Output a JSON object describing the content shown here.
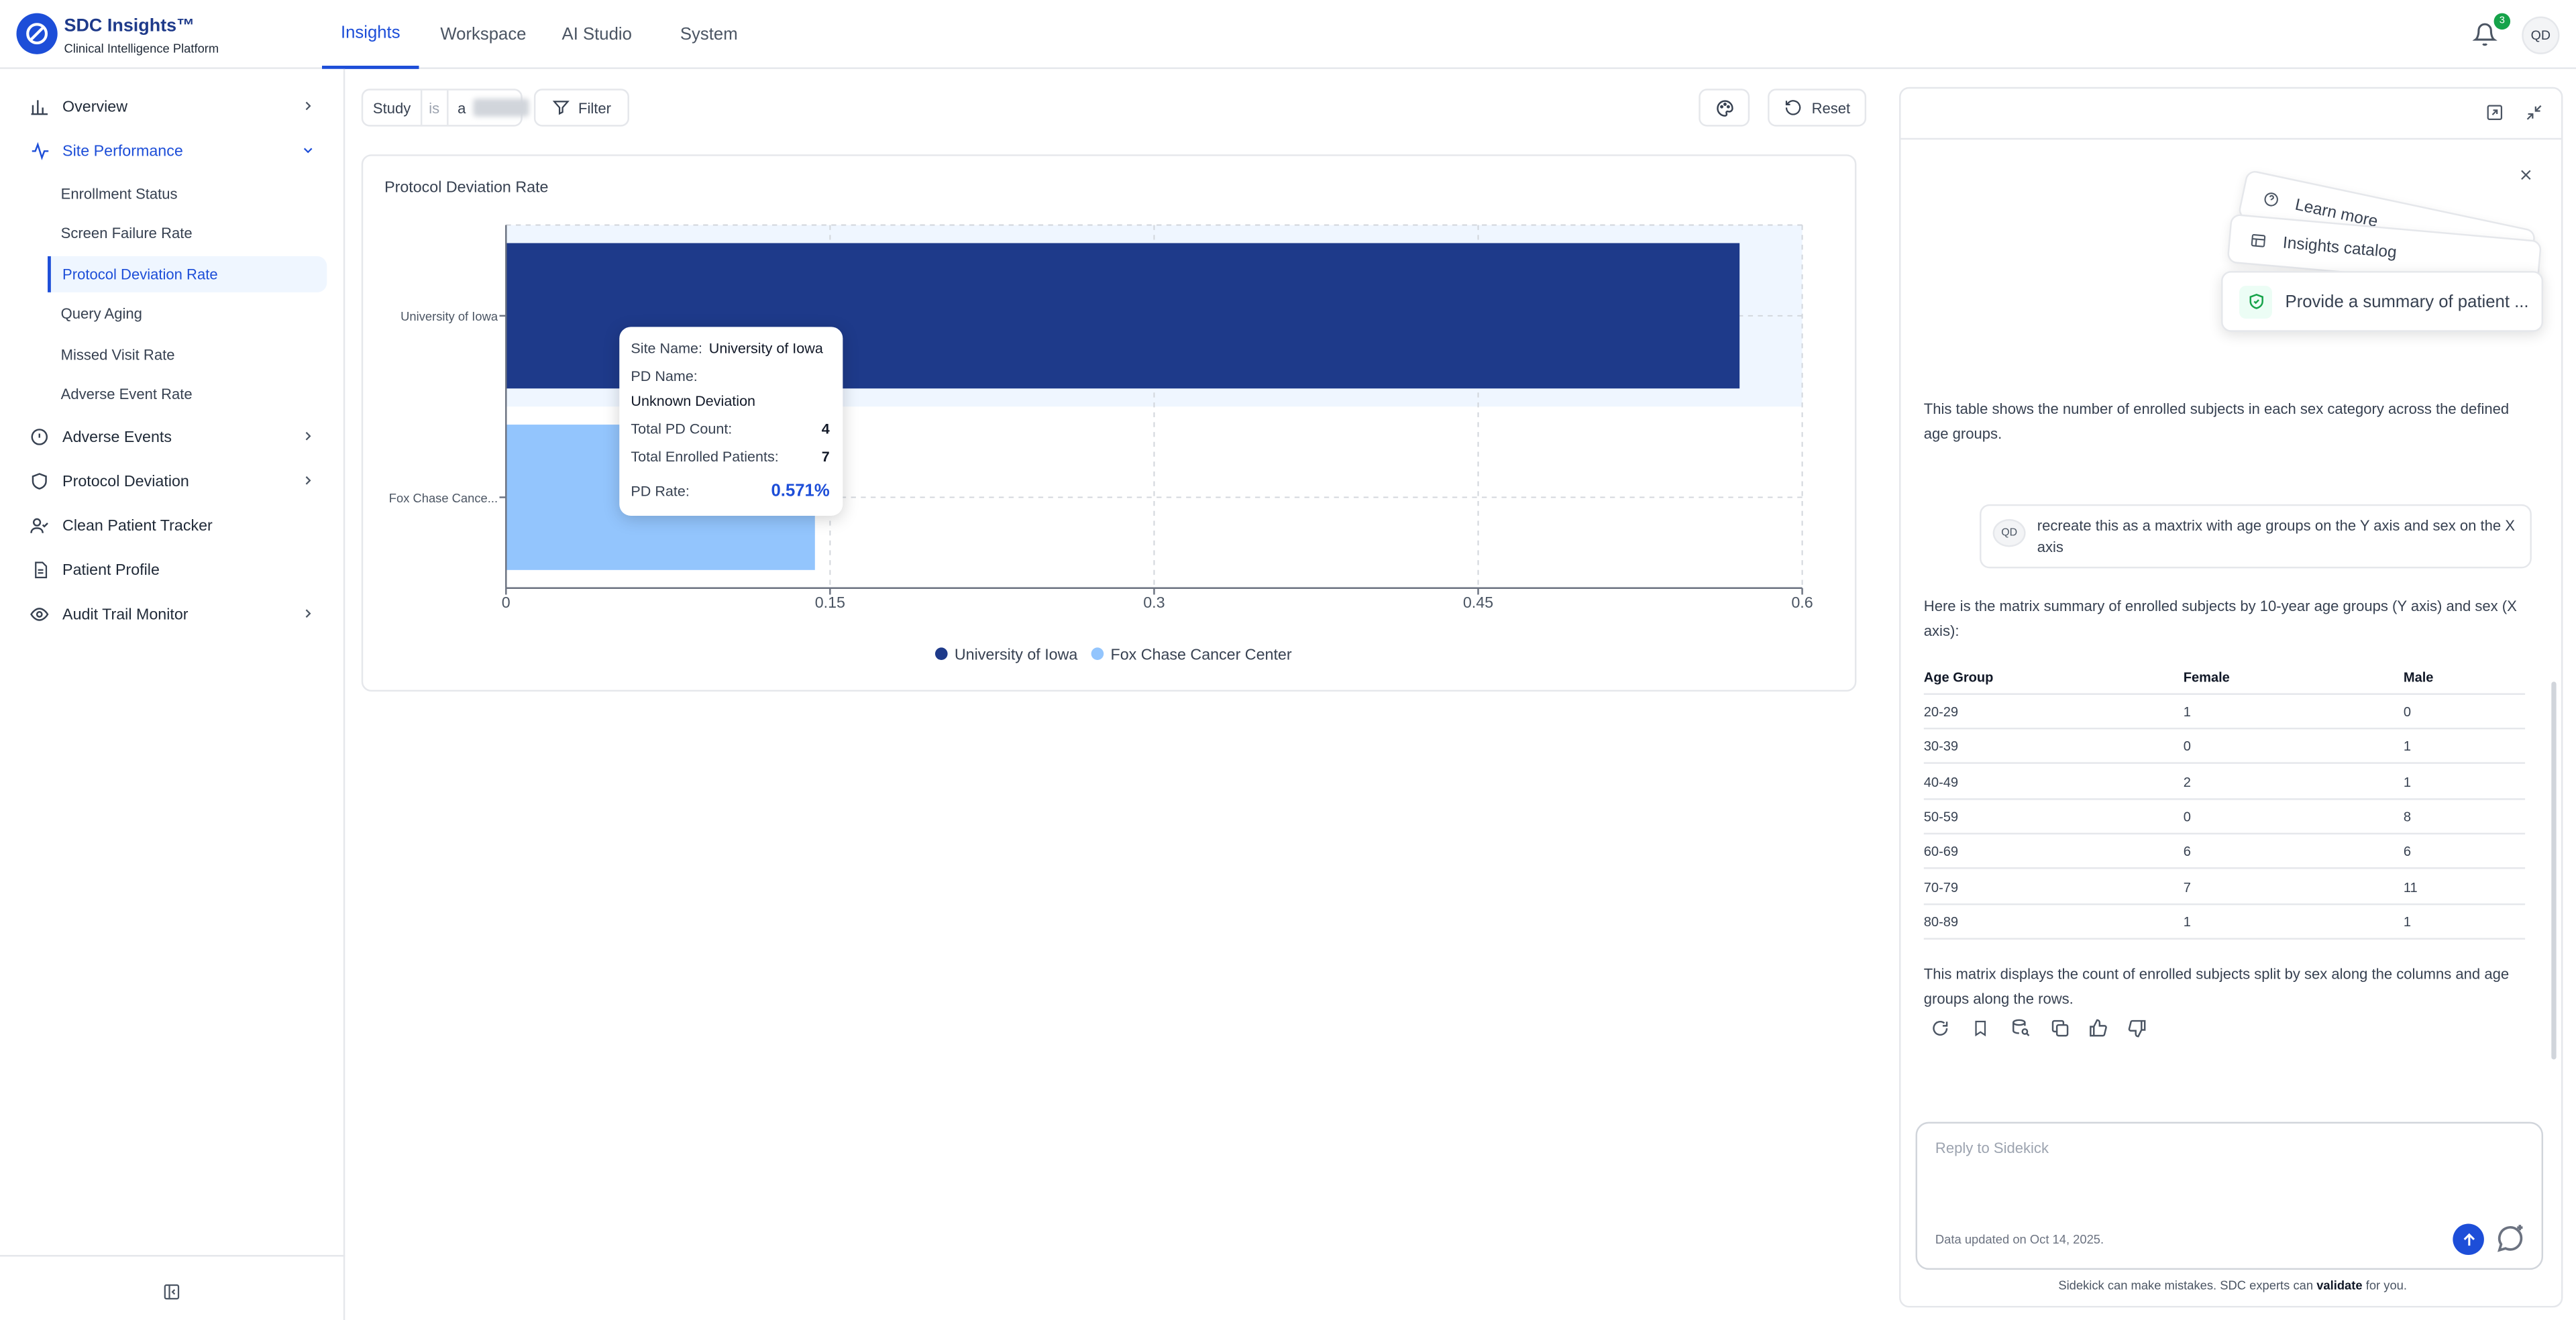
{
  "brand": {
    "title": "SDC Insights™",
    "subtitle": "Clinical Intelligence Platform"
  },
  "nav": {
    "tabs": [
      "Insights",
      "Workspace",
      "AI Studio",
      "System"
    ],
    "active": "Insights"
  },
  "header": {
    "notification_count": "3",
    "avatar_initials": "QD"
  },
  "sidebar": {
    "items": [
      {
        "label": "Overview",
        "icon": "bar-chart-icon"
      },
      {
        "label": "Site Performance",
        "icon": "activity-icon"
      },
      {
        "label": "Adverse Events",
        "icon": "alert-circle-icon"
      },
      {
        "label": "Protocol Deviation",
        "icon": "shield-icon"
      },
      {
        "label": "Clean Patient Tracker",
        "icon": "user-check-icon"
      },
      {
        "label": "Patient Profile",
        "icon": "document-icon"
      },
      {
        "label": "Audit Trail Monitor",
        "icon": "eye-icon"
      }
    ],
    "sub_items": [
      "Enrollment Status",
      "Screen Failure Rate",
      "Protocol Deviation Rate",
      "Query Aging",
      "Missed Visit Rate",
      "Adverse Event Rate"
    ],
    "active_sub": "Protocol Deviation Rate"
  },
  "filters": {
    "field": "Study",
    "operator": "is",
    "value_prefix": "a",
    "filter_label": "Filter",
    "reset_label": "Reset"
  },
  "chart_data": {
    "type": "bar",
    "orientation": "horizontal",
    "title": "Protocol Deviation Rate",
    "categories": [
      "University of Iowa",
      "Fox Chase Cance..."
    ],
    "series": [
      {
        "name": "University of Iowa",
        "values": [
          0.571,
          null
        ],
        "color": "#1e3a8a"
      },
      {
        "name": "Fox Chase Cancer Center",
        "values": [
          null,
          0.143
        ],
        "color": "#93c5fd"
      }
    ],
    "xlim": [
      0,
      0.6
    ],
    "xticks": [
      "0",
      "0.15",
      "0.3",
      "0.45",
      "0.6"
    ],
    "grid": true,
    "legend": "bottom"
  },
  "tooltip": {
    "site_label": "Site Name:",
    "site_value": "University of Iowa",
    "pd_label": "PD Name:",
    "pd_value": "Unknown Deviation",
    "count_label": "Total PD Count:",
    "count_value": "4",
    "enrolled_label": "Total Enrolled Patients:",
    "enrolled_value": "7",
    "rate_label": "PD Rate:",
    "rate_value": "0.571%"
  },
  "sidekick": {
    "suggestions": [
      "Learn more",
      "Insights catalog",
      "Provide a summary of patient ..."
    ],
    "msg1": "This table shows the number of enrolled subjects in each sex category across the defined age groups.",
    "user_initials": "QD",
    "user_msg": "recreate this as a maxtrix with age groups on the Y axis and sex on the X axis",
    "msg2": "Here is the matrix summary of enrolled subjects by 10-year age groups (Y axis) and sex (X axis):",
    "table": {
      "headers": [
        "Age Group",
        "Female",
        "Male"
      ],
      "rows": [
        [
          "20-29",
          "1",
          "0"
        ],
        [
          "30-39",
          "0",
          "1"
        ],
        [
          "40-49",
          "2",
          "1"
        ],
        [
          "50-59",
          "0",
          "8"
        ],
        [
          "60-69",
          "6",
          "6"
        ],
        [
          "70-79",
          "7",
          "11"
        ],
        [
          "80-89",
          "1",
          "1"
        ]
      ]
    },
    "msg3": "This matrix displays the count of enrolled subjects split by sex along the columns and age groups along the rows.",
    "reply_placeholder": "Reply to Sidekick",
    "data_updated": "Data updated on Oct 14, 2025.",
    "disclaimer_pre": "Sidekick can make mistakes. SDC experts can ",
    "disclaimer_link": "validate",
    "disclaimer_post": " for you."
  },
  "colors": {
    "accent": "#1d4ed8",
    "bar_primary": "#1e3a8a",
    "bar_secondary": "#93c5fd",
    "success": "#16a34a"
  }
}
